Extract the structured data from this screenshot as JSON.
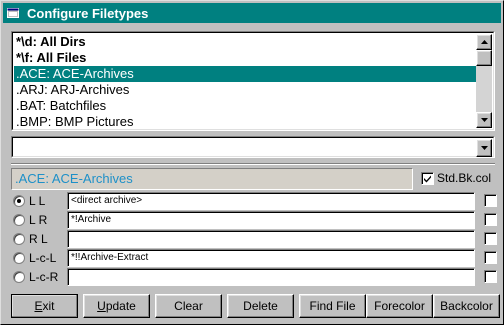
{
  "window": {
    "title": "Configure Filetypes"
  },
  "filetypes": {
    "items": [
      "*\\d: All Dirs",
      "*\\f: All Files",
      ".ACE: ACE-Archives",
      ".ARJ: ARJ-Archives",
      ".BAT: Batchfiles",
      ".BMP: BMP Pictures"
    ],
    "selected_index": 2
  },
  "combo": {
    "value": ""
  },
  "current": {
    "value": ".ACE: ACE-Archives"
  },
  "stdbkcol": {
    "label": "Std.Bk.col",
    "checked": true
  },
  "actions": [
    {
      "label": "L L",
      "value": "<direct archive>",
      "selected": true,
      "checked": false
    },
    {
      "label": "L R",
      "value": "*!Archive",
      "selected": false,
      "checked": false
    },
    {
      "label": "R L",
      "value": "",
      "selected": false,
      "checked": false
    },
    {
      "label": "L-c-L",
      "value": "*!!Archive-Extract",
      "selected": false,
      "checked": false
    },
    {
      "label": "L-c-R",
      "value": "",
      "selected": false,
      "checked": false
    }
  ],
  "buttons": {
    "exit": {
      "pre": "",
      "u": "E",
      "post": "xit"
    },
    "update": {
      "pre": "",
      "u": "U",
      "post": "pdate"
    },
    "clear": "Clear",
    "delete": "Delete",
    "findfile": "Find File",
    "forecolor": "Forecolor",
    "backcolor": "Backcolor"
  },
  "colors": {
    "titlebar": "#008080",
    "selection": "#008080",
    "current_text": "#1e90c8",
    "face": "#c0c0c0"
  }
}
